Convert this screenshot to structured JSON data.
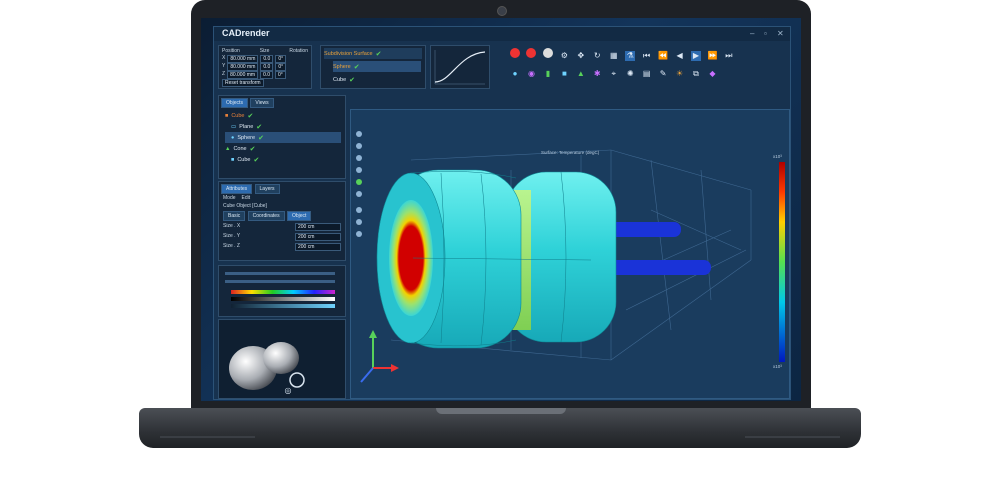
{
  "app": {
    "title": "CADrender"
  },
  "titlebar": {
    "minimize": "–",
    "maximize": "▫",
    "close": "✕"
  },
  "params": {
    "headers": [
      "Position",
      "Size",
      "Rotation"
    ],
    "rows": [
      [
        "X",
        "80.000 mm",
        "0.0",
        "0°"
      ],
      [
        "Y",
        "80.000 mm",
        "0.0",
        "0°"
      ],
      [
        "Z",
        "80.000 mm",
        "0.0",
        "0°"
      ]
    ],
    "reset_label": "Reset transform"
  },
  "surfaces": {
    "header": "Subdivision Surface",
    "items": [
      "Sphere",
      "Cube"
    ]
  },
  "objects_panel": {
    "tabs": [
      "Objects",
      "Views"
    ],
    "items": [
      {
        "label": "Cube",
        "color": "#e8813a"
      },
      {
        "label": "Plane",
        "color": "#6fd3ff"
      },
      {
        "label": "Sphere",
        "color": "#ffffff"
      },
      {
        "label": "Cone",
        "color": "#ffffff"
      },
      {
        "label": "Cube",
        "color": "#ffffff"
      }
    ]
  },
  "attributes": {
    "tabs": [
      "Attributes",
      "Layers"
    ],
    "mode_items": [
      "Mode",
      "Edit"
    ],
    "object_label": "Cube Object [Cube]",
    "subtabs": [
      "Basic",
      "Coordinates",
      "Object"
    ],
    "fields": [
      {
        "label": "Size . X",
        "value": "200 cm"
      },
      {
        "label": "Size . Y",
        "value": "200 cm"
      },
      {
        "label": "Size . Z",
        "value": "200 cm"
      }
    ]
  },
  "viewport": {
    "title": "Surface: Temperature (degC)",
    "colorbar_top": "x10³",
    "colorbar_bottom": "x10³"
  },
  "colors": {
    "accent": "#2d6bb0",
    "highlight": "#e8a13a",
    "check": "#58d15a"
  }
}
